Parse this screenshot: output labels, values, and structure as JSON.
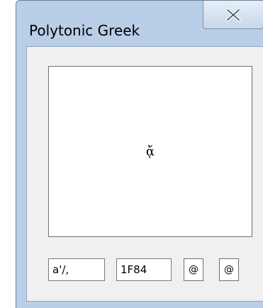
{
  "window": {
    "title": "Polytonic Greek",
    "close_icon": "close-icon"
  },
  "preview": {
    "glyph": "ᾄ"
  },
  "inputs": {
    "sequence": "a'/,",
    "codepoint": "1F84"
  },
  "buttons": {
    "button1_label": "@",
    "button2_label": "@"
  }
}
